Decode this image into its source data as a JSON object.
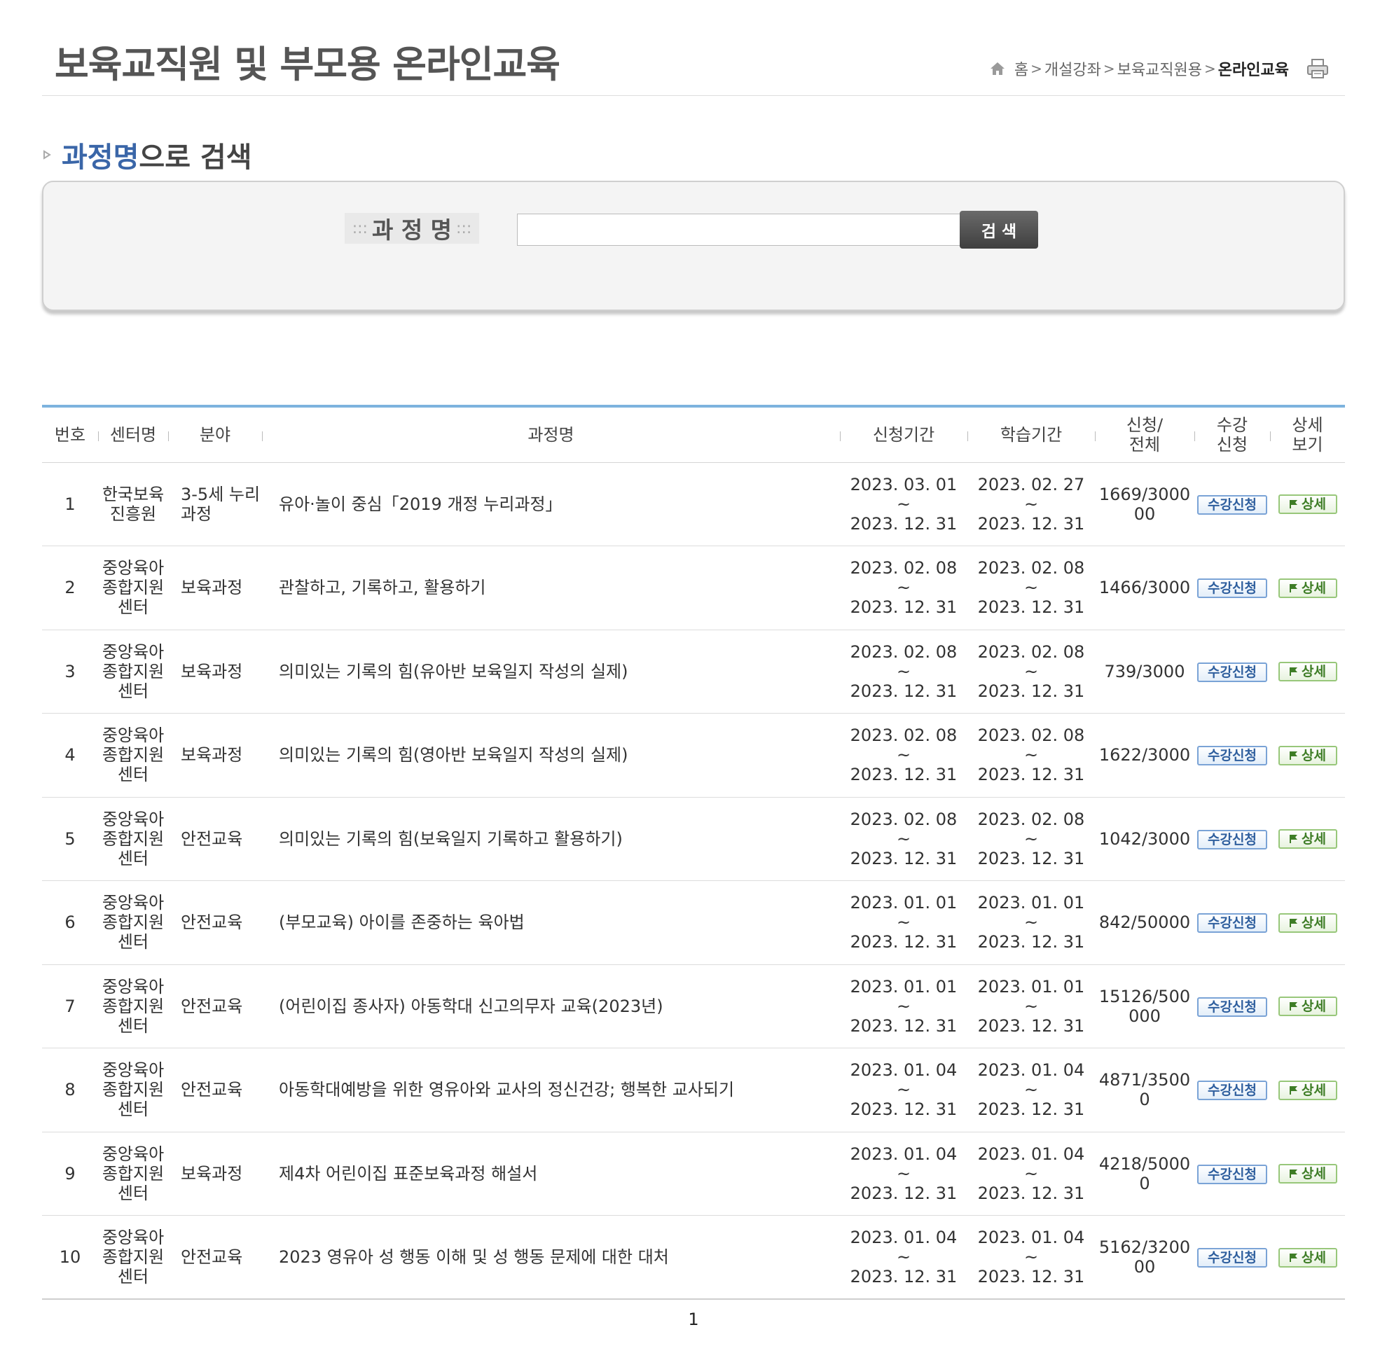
{
  "header": {
    "title": "보육교직원 및 부모용 온라인교육",
    "breadcrumb": [
      "홈",
      "개설강좌",
      "보육교직원용",
      "온라인교육"
    ],
    "icons": {
      "home": "home-icon",
      "print": "print-icon"
    }
  },
  "search": {
    "heading_accent": "과정명",
    "heading_rest": "으로 검색",
    "label": "과 정 명",
    "label_decoration": ":::",
    "input_value": "",
    "button_label": "검 색"
  },
  "table": {
    "headers": {
      "no": "번호",
      "center": "센터명",
      "category": "분야",
      "course": "과정명",
      "apply_period": "신청기간",
      "study_period": "학습기간",
      "enrollment_1": "신청/",
      "enrollment_2": "전체",
      "register_1": "수강",
      "register_2": "신청",
      "detail_1": "상세",
      "detail_2": "보기"
    },
    "apply_label": "수강신청",
    "detail_label": "상세",
    "date_separator": "~",
    "rows": [
      {
        "no": "1",
        "center": "한국보육진흥원",
        "category": "3-5세 누리과정",
        "course": "유아·놀이 중심「2019 개정 누리과정」",
        "apply_start": "2023. 03. 01",
        "apply_end": "2023. 12. 31",
        "study_start": "2023. 02. 27",
        "study_end": "2023. 12. 31",
        "count": "1669/300000"
      },
      {
        "no": "2",
        "center": "중앙육아종합지원센터",
        "category": "보육과정",
        "course": "관찰하고, 기록하고, 활용하기",
        "apply_start": "2023. 02. 08",
        "apply_end": "2023. 12. 31",
        "study_start": "2023. 02. 08",
        "study_end": "2023. 12. 31",
        "count": "1466/3000"
      },
      {
        "no": "3",
        "center": "중앙육아종합지원센터",
        "category": "보육과정",
        "course": "의미있는 기록의 힘(유아반 보육일지 작성의 실제)",
        "apply_start": "2023. 02. 08",
        "apply_end": "2023. 12. 31",
        "study_start": "2023. 02. 08",
        "study_end": "2023. 12. 31",
        "count": "739/3000"
      },
      {
        "no": "4",
        "center": "중앙육아종합지원센터",
        "category": "보육과정",
        "course": "의미있는 기록의 힘(영아반 보육일지 작성의 실제)",
        "apply_start": "2023. 02. 08",
        "apply_end": "2023. 12. 31",
        "study_start": "2023. 02. 08",
        "study_end": "2023. 12. 31",
        "count": "1622/3000"
      },
      {
        "no": "5",
        "center": "중앙육아종합지원센터",
        "category": "안전교육",
        "course": "의미있는 기록의 힘(보육일지 기록하고 활용하기)",
        "apply_start": "2023. 02. 08",
        "apply_end": "2023. 12. 31",
        "study_start": "2023. 02. 08",
        "study_end": "2023. 12. 31",
        "count": "1042/3000"
      },
      {
        "no": "6",
        "center": "중앙육아종합지원센터",
        "category": "안전교육",
        "course": "(부모교육) 아이를 존중하는 육아법",
        "apply_start": "2023. 01. 01",
        "apply_end": "2023. 12. 31",
        "study_start": "2023. 01. 01",
        "study_end": "2023. 12. 31",
        "count": "842/50000"
      },
      {
        "no": "7",
        "center": "중앙육아종합지원센터",
        "category": "안전교육",
        "course": "(어린이집 종사자) 아동학대 신고의무자 교육(2023년)",
        "apply_start": "2023. 01. 01",
        "apply_end": "2023. 12. 31",
        "study_start": "2023. 01. 01",
        "study_end": "2023. 12. 31",
        "count": "15126/500000"
      },
      {
        "no": "8",
        "center": "중앙육아종합지원센터",
        "category": "안전교육",
        "course": "아동학대예방을 위한 영유아와 교사의 정신건강; 행복한 교사되기",
        "apply_start": "2023. 01. 04",
        "apply_end": "2023. 12. 31",
        "study_start": "2023. 01. 04",
        "study_end": "2023. 12. 31",
        "count": "4871/35000"
      },
      {
        "no": "9",
        "center": "중앙육아종합지원센터",
        "category": "보육과정",
        "course": "제4차 어린이집 표준보육과정 해설서",
        "apply_start": "2023. 01. 04",
        "apply_end": "2023. 12. 31",
        "study_start": "2023. 01. 04",
        "study_end": "2023. 12. 31",
        "count": "4218/50000"
      },
      {
        "no": "10",
        "center": "중앙육아종합지원센터",
        "category": "안전교육",
        "course": "2023 영유아 성 행동 이해 및 성 행동 문제에 대한 대처",
        "apply_start": "2023. 01. 04",
        "apply_end": "2023. 12. 31",
        "study_start": "2023. 01. 04",
        "study_end": "2023. 12. 31",
        "count": "5162/320000"
      }
    ]
  },
  "pagination": {
    "current": "1"
  },
  "colors": {
    "accent": "#3a66a8",
    "table_top_border": "#7db3de",
    "apply_button": "#2f5f9e",
    "detail_button": "#3e7d26"
  }
}
